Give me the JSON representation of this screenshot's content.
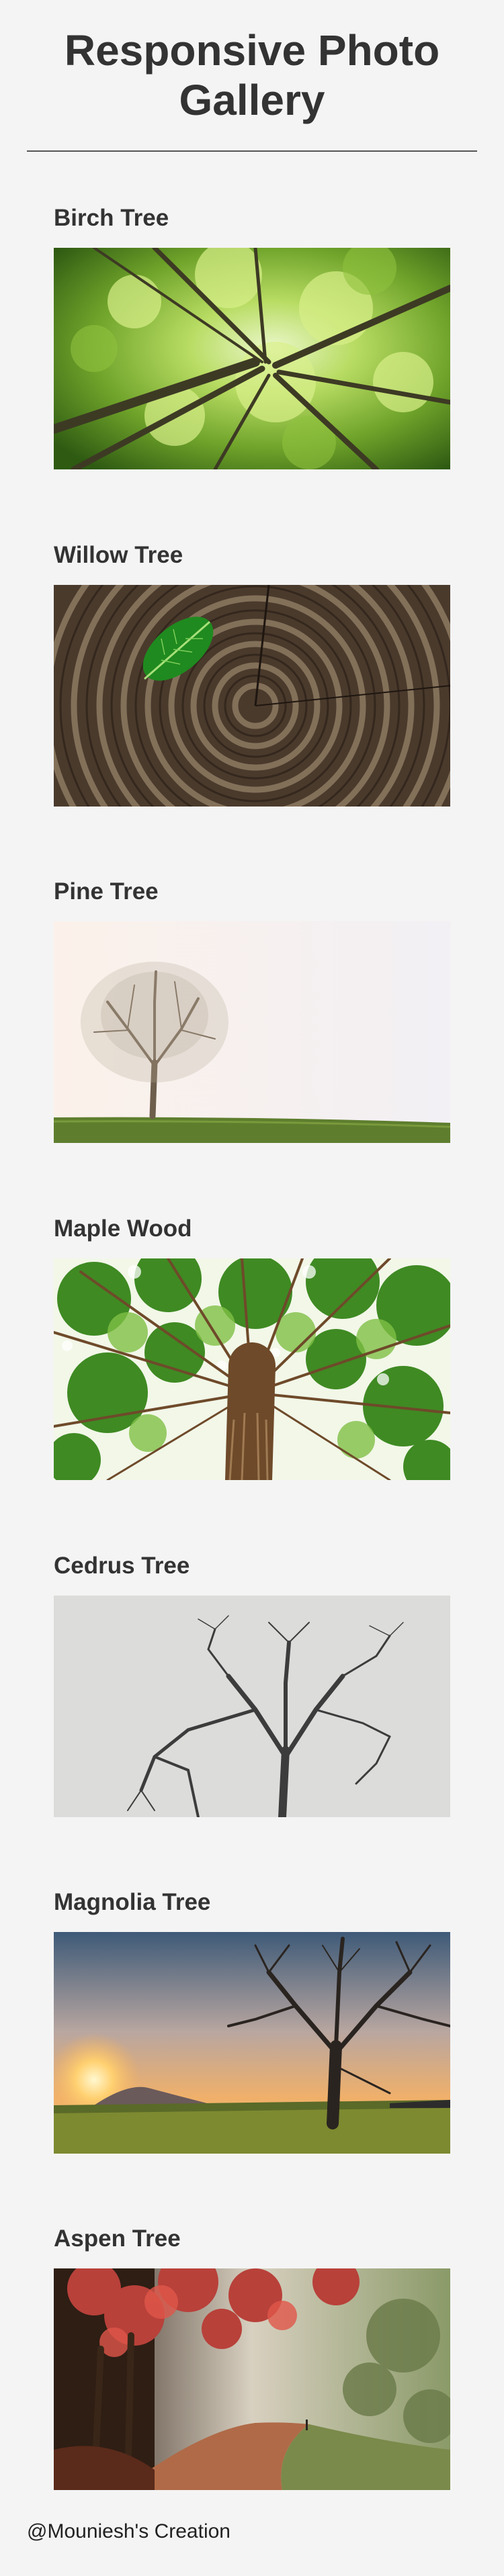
{
  "page": {
    "title": "Responsive Photo Gallery",
    "background": "#f4f4f4",
    "text_color": "#333333"
  },
  "gallery": {
    "items": [
      {
        "title": "Birch Tree",
        "image": "birch-canopy-photo"
      },
      {
        "title": "Willow Tree",
        "image": "leaf-on-tree-rings-photo"
      },
      {
        "title": "Pine Tree",
        "image": "lone-tree-on-hill-photo"
      },
      {
        "title": "Maple Wood",
        "image": "maple-canopy-photo"
      },
      {
        "title": "Cedrus Tree",
        "image": "bare-tree-grey-sky-photo"
      },
      {
        "title": "Magnolia Tree",
        "image": "bare-tree-sunset-photo"
      },
      {
        "title": "Aspen Tree",
        "image": "autumn-forest-path-photo"
      }
    ]
  },
  "footer": {
    "text": "@Mouniesh's Creation"
  }
}
